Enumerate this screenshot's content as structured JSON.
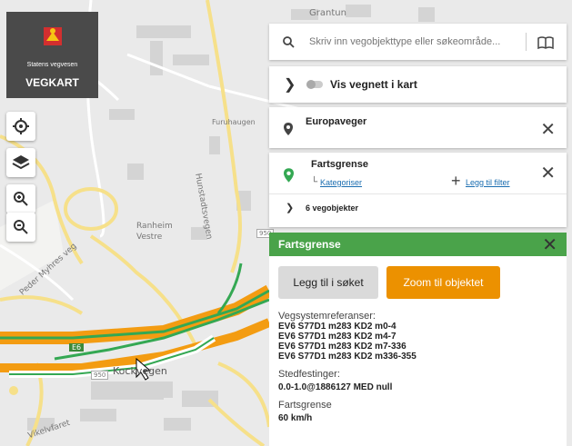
{
  "brand": {
    "org_name": "Statens vegvesen",
    "app_name": "VEGKART"
  },
  "map_labels": {
    "grantun": "Grantun",
    "furuhaugen": "Furuhaugen",
    "hunstadtsvegen": "Hunstadtsvegen",
    "ranheim": "Ranheim",
    "vestre": "Vestre",
    "peder_myhres_veg": "Peder Myhres veg",
    "kockvegen": "Kockvegen",
    "vikelvfaret": "Vikelvfaret",
    "route_e6": "E6",
    "route_950_a": "950",
    "route_950_b": "950"
  },
  "search": {
    "placeholder": "Skriv inn vegobjekttype eller søkeområde..."
  },
  "network_toggle": {
    "label": "Vis vegnett i kart",
    "on": false
  },
  "filter_europaveger": {
    "title": "Europaveger"
  },
  "filter_fartsgrense": {
    "title": "Fartsgrense",
    "categorize": "Kategoriser",
    "add_filter": "Legg til filter"
  },
  "results": {
    "count_text": "6 vegobjekter"
  },
  "detail": {
    "title": "Fartsgrense",
    "add_to_search": "Legg til i søket",
    "zoom_to_object": "Zoom til objektet",
    "ref_label": "Vegsystemreferanser:",
    "refs": [
      "EV6 S77D1 m283 KD2 m0-4",
      "EV6 S77D1 m283 KD2 m4-7",
      "EV6 S77D1 m283 KD2 m7-336",
      "EV6 S77D1 m283 KD2 m336-355"
    ],
    "location_label": "Stedfestinger:",
    "location_value": "0.0-1.0@1886127 MED null",
    "speed_label": "Fartsgrense",
    "speed_value": "60 km/h"
  },
  "colors": {
    "header_green": "#4aa34a",
    "zoom_orange": "#ec9100",
    "road_orange": "#f39c12",
    "road_green": "#34a853",
    "link_blue": "#1a6db0"
  }
}
